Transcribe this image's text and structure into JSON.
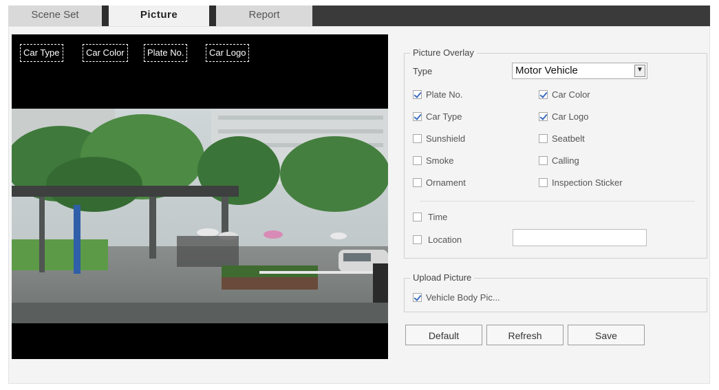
{
  "tabs": [
    {
      "label": "Scene Set",
      "active": false
    },
    {
      "label": "Picture",
      "active": true
    },
    {
      "label": "Report",
      "active": false
    }
  ],
  "preview": {
    "overlay_labels": [
      "Car Type",
      "Car Color",
      "Plate No.",
      "Car Logo"
    ]
  },
  "picture_overlay": {
    "title": "Picture Overlay",
    "type_label": "Type",
    "type_value": "Motor Vehicle",
    "options": [
      {
        "label": "Plate No.",
        "checked": true
      },
      {
        "label": "Car Color",
        "checked": true
      },
      {
        "label": "Car Type",
        "checked": true
      },
      {
        "label": "Car Logo",
        "checked": true
      },
      {
        "label": "Sunshield",
        "checked": false
      },
      {
        "label": "Seatbelt",
        "checked": false
      },
      {
        "label": "Smoke",
        "checked": false
      },
      {
        "label": "Calling",
        "checked": false
      },
      {
        "label": "Ornament",
        "checked": false
      },
      {
        "label": "Inspection Sticker",
        "checked": false
      }
    ],
    "time": {
      "label": "Time",
      "checked": false
    },
    "location": {
      "label": "Location",
      "checked": false,
      "value": ""
    }
  },
  "upload_picture": {
    "title": "Upload Picture",
    "vehicle_body": {
      "label": "Vehicle Body Pic...",
      "checked": true
    }
  },
  "buttons": {
    "default_label": "Default",
    "refresh_label": "Refresh",
    "save_label": "Save"
  },
  "colors": {
    "check_accent": "#3b6dbf",
    "tab_bar": "#3a3a3a"
  }
}
